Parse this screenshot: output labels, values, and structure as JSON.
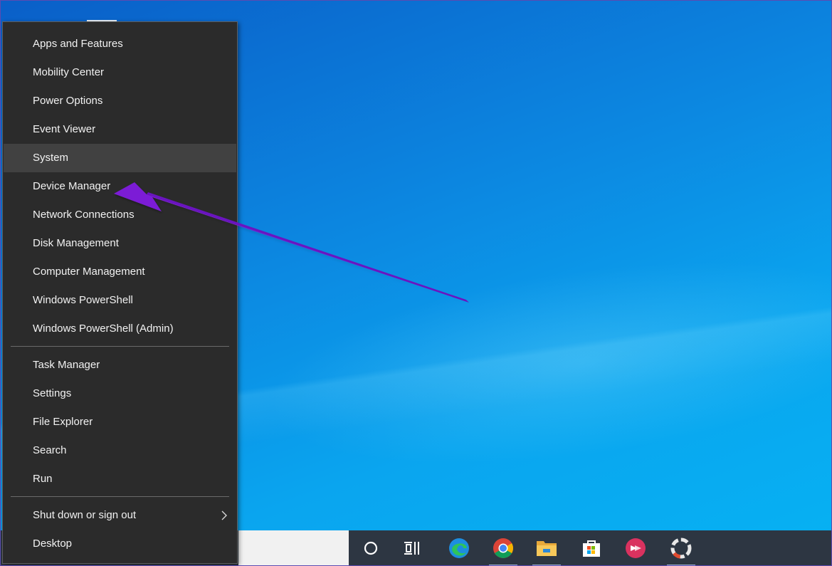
{
  "menu": {
    "group1": [
      {
        "label": "Apps and Features"
      },
      {
        "label": "Mobility Center"
      },
      {
        "label": "Power Options"
      },
      {
        "label": "Event Viewer"
      },
      {
        "label": "System"
      },
      {
        "label": "Device Manager"
      },
      {
        "label": "Network Connections"
      },
      {
        "label": "Disk Management"
      },
      {
        "label": "Computer Management"
      },
      {
        "label": "Windows PowerShell"
      },
      {
        "label": "Windows PowerShell (Admin)"
      }
    ],
    "group2": [
      {
        "label": "Task Manager"
      },
      {
        "label": "Settings"
      },
      {
        "label": "File Explorer"
      },
      {
        "label": "Search"
      },
      {
        "label": "Run"
      }
    ],
    "group3": [
      {
        "label": "Shut down or sign out"
      },
      {
        "label": "Desktop"
      }
    ],
    "hovered_item": "System"
  },
  "taskbar": {
    "icons": [
      "cortana-icon",
      "task-view-icon",
      "edge-icon",
      "chrome-icon",
      "file-explorer-icon",
      "store-icon",
      "app-icon",
      "recorder-icon"
    ]
  },
  "colors": {
    "menu_bg": "#2b2b2b",
    "hover_bg": "#414141",
    "annotation_arrow": "#7b1fd6",
    "taskbar_bg": "#2d3642"
  }
}
